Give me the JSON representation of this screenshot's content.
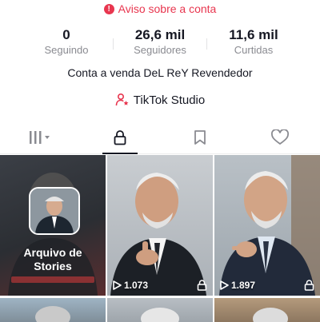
{
  "warning": {
    "text": "Aviso sobre a conta",
    "icon": "alert-circle-icon",
    "color": "#e8364f"
  },
  "stats": [
    {
      "value": "0",
      "label": "Seguindo"
    },
    {
      "value": "26,6 mil",
      "label": "Seguidores"
    },
    {
      "value": "11,6 mil",
      "label": "Curtidas"
    }
  ],
  "bio": "Conta a venda DeL ReY Revendedor",
  "studio": {
    "label": "TikTok Studio",
    "icon": "person-star-icon",
    "icon_color": "#e8364f"
  },
  "tabs": [
    {
      "name": "videos",
      "icon": "grid-icon",
      "active": false
    },
    {
      "name": "private",
      "icon": "lock-icon",
      "active": true
    },
    {
      "name": "favorites",
      "icon": "bookmark-icon",
      "active": false
    },
    {
      "name": "liked",
      "icon": "heart-icon",
      "active": false
    }
  ],
  "grid": {
    "archive": {
      "title_line1": "Arquivo de",
      "title_line2": "Stories"
    },
    "videos": [
      {
        "views": "1.073",
        "locked": true
      },
      {
        "views": "1.897",
        "locked": true
      }
    ]
  }
}
